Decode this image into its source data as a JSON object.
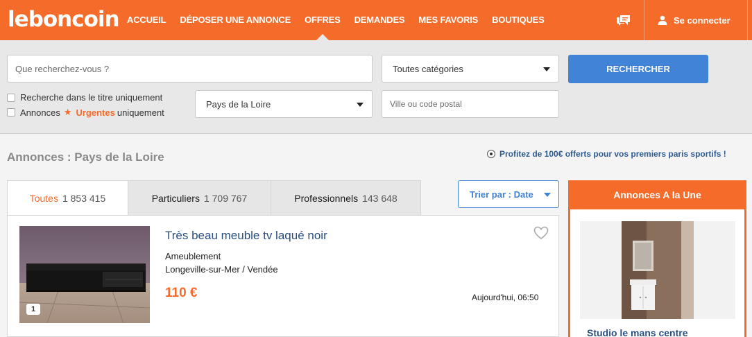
{
  "header": {
    "logo": "leboncoin",
    "nav": [
      "ACCUEIL",
      "DÉPOSER UNE ANNONCE",
      "OFFRES",
      "DEMANDES",
      "MES FAVORIS",
      "BOUTIQUES"
    ],
    "active_nav": "OFFRES",
    "login_label": "Se connecter"
  },
  "search": {
    "query_placeholder": "Que recherchez-vous ?",
    "category_value": "Toutes catégories",
    "region_value": "Pays de la Loire",
    "city_placeholder": "Ville ou code postal",
    "search_button": "RECHERCHER",
    "title_only_label": "Recherche dans le titre uniquement",
    "urgent_prefix": "Annonces",
    "urgent_word": "Urgentes",
    "urgent_suffix": "uniquement"
  },
  "main": {
    "page_title": "Annonces : Pays de la Loire",
    "promo": "Profitez de 100€ offerts pour vos premiers paris sportifs !",
    "tabs": [
      {
        "label": "Toutes",
        "count": "1 853 415"
      },
      {
        "label": "Particuliers",
        "count": "1 709 767"
      },
      {
        "label": "Professionnels",
        "count": "143 648"
      }
    ],
    "sort_label": "Trier par : Date",
    "listing": {
      "title": "Très beau meuble tv laqué noir",
      "category": "Ameublement",
      "location": "Longeville-sur-Mer / Vendée",
      "price": "110 €",
      "date": "Aujourd'hui, 06:50",
      "photo_count": "1"
    }
  },
  "featured": {
    "header": "Annonces A la Une",
    "title": "Studio le mans centre"
  },
  "colors": {
    "brand": "#f56b2a",
    "action": "#4183d7",
    "link": "#2b4f7e"
  }
}
